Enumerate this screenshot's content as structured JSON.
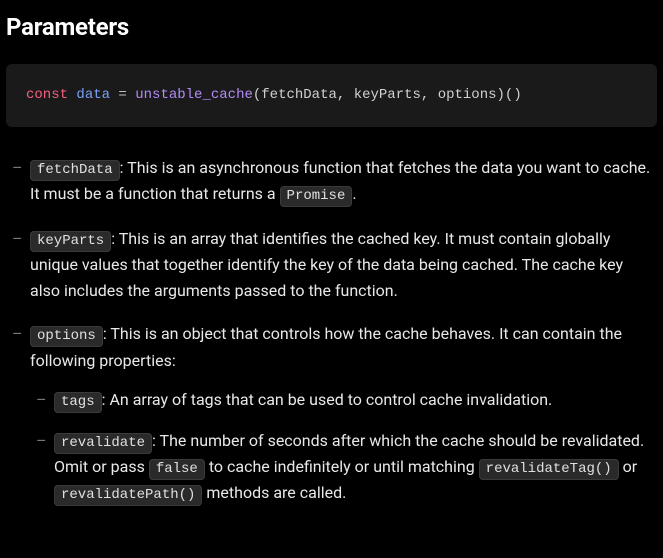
{
  "heading": "Parameters",
  "code": {
    "kw": "const",
    "varname": "data",
    "eq": " = ",
    "fn": "unstable_cache",
    "call": "(fetchData, keyParts, options)()"
  },
  "items": [
    {
      "term": "fetchData",
      "desc_before": ": This is an asynchronous function that fetches the data you want to cache. It must be a function that returns a ",
      "inline1": "Promise",
      "desc_after": "."
    },
    {
      "term": "keyParts",
      "desc_before": ": This is an array that identifies the cached key. It must contain globally unique values that together identify the key of the data being cached. The cache key also includes the arguments passed to the function."
    },
    {
      "term": "options",
      "desc_before": ": This is an object that controls how the cache behaves. It can contain the following properties:",
      "children": [
        {
          "term": "tags",
          "desc_before": ": An array of tags that can be used to control cache invalidation."
        },
        {
          "term": "revalidate",
          "desc_before": ": The number of seconds after which the cache should be revalidated. Omit or pass ",
          "inline1": "false",
          "mid1": " to cache indefinitely or until matching ",
          "inline2": "revalidateTag()",
          "mid2": " or ",
          "inline3": "revalidatePath()",
          "desc_after": " methods are called."
        }
      ]
    }
  ]
}
